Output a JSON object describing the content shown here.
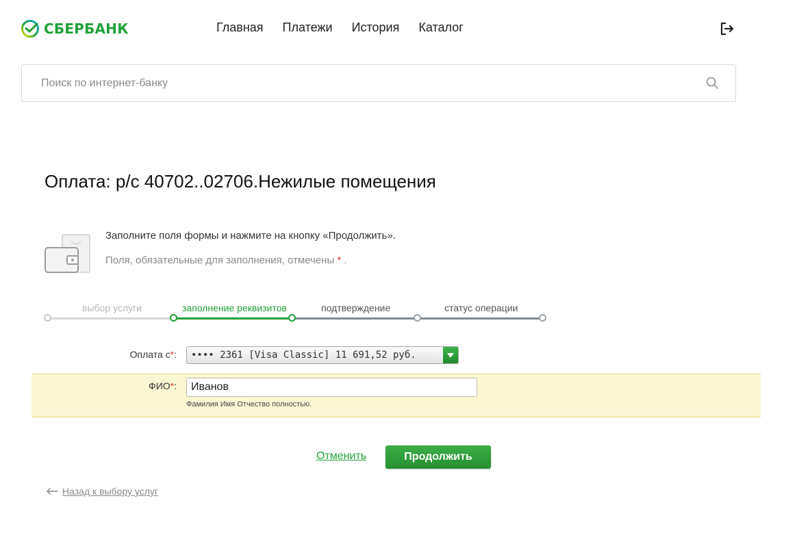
{
  "brand": {
    "name": "СБЕРБАНК",
    "color": "#21a038"
  },
  "nav": [
    {
      "label": "Главная"
    },
    {
      "label": "Платежи"
    },
    {
      "label": "История"
    },
    {
      "label": "Каталог"
    }
  ],
  "header": {
    "logout_icon": "logout-icon"
  },
  "search": {
    "placeholder": "Поиск по интернет-банку",
    "icon": "search-icon"
  },
  "page": {
    "title": "Оплата: р/с 40702..02706.Нежилые помещения"
  },
  "hint": {
    "line1": "Заполните поля формы и нажмите на кнопку «Продолжить».",
    "line2": "Поля, обязательные для заполнения, отмечены",
    "star": "*",
    "line2_end": "."
  },
  "steps": [
    {
      "label": "выбор услуги",
      "state": "done"
    },
    {
      "label": "заполнение реквизитов",
      "state": "active"
    },
    {
      "label": "подтверждение",
      "state": "pending"
    },
    {
      "label": "статус операции",
      "state": "pending"
    }
  ],
  "form": {
    "payment_from": {
      "label": "Оплата с",
      "required": "*",
      "suffix": ":",
      "value": "•••• 2361 [Visa Classic] 11 691,52 руб."
    },
    "fio": {
      "label": "ФИО",
      "required": "*",
      "suffix": ":",
      "value": "Иванов",
      "help": "Фамилия Имя Отчество полностью."
    }
  },
  "actions": {
    "cancel": "Отменить",
    "continue": "Продолжить",
    "back": "Назад к выбору услуг"
  },
  "colors": {
    "accent": "#21a038",
    "required": "#e53935",
    "highlight_band": "#fbf7d2"
  }
}
